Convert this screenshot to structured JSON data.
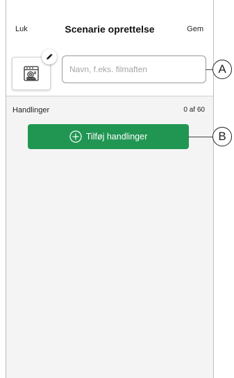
{
  "header": {
    "close_label": "Luk",
    "title": "Scenarie oprettelse",
    "save_label": "Gem"
  },
  "scene": {
    "icon": "dishwasher-icon",
    "edit_icon": "pencil-icon",
    "name_placeholder": "Navn, f.eks. filmaften",
    "name_value": ""
  },
  "actions": {
    "section_label": "Handlinger",
    "count": "0 af 60",
    "add_button_label": "Tilføj handlinger",
    "add_icon": "plus-circle-icon"
  },
  "callouts": {
    "a": "A",
    "b": "B"
  },
  "colors": {
    "accent": "#219653",
    "background": "#f4f4f4"
  }
}
